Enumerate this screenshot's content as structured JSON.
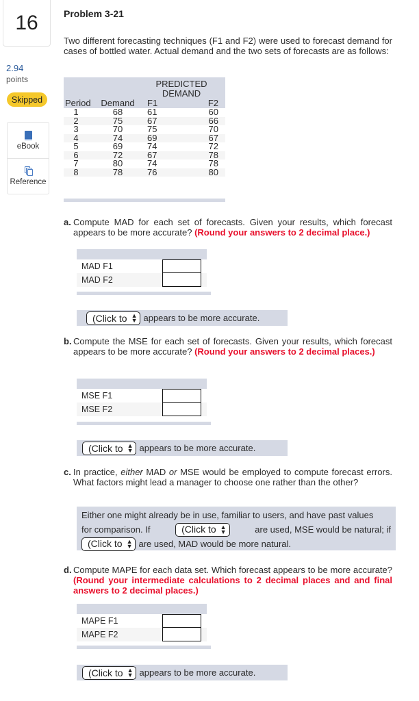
{
  "sidebar": {
    "question_number": "16",
    "points_value": "2.94",
    "points_label": "points",
    "status_badge": "Skipped",
    "tools": [
      {
        "label": "eBook",
        "icon": "book-icon"
      },
      {
        "label": "Reference",
        "icon": "copy-icon"
      }
    ]
  },
  "problem": {
    "title": "Problem 3-21",
    "intro": "Two different forecasting techniques (F1 and F2) were used to forecast demand for cases of bottled water. Actual demand and the two sets of forecasts are as follows:"
  },
  "data_table": {
    "group_header": [
      "PREDICTED",
      "DEMAND"
    ],
    "headers": [
      "Period",
      "Demand",
      "F1",
      "F2"
    ],
    "rows": [
      [
        "1",
        "68",
        "61",
        "60"
      ],
      [
        "2",
        "75",
        "67",
        "66"
      ],
      [
        "3",
        "70",
        "75",
        "70"
      ],
      [
        "4",
        "74",
        "69",
        "67"
      ],
      [
        "5",
        "69",
        "74",
        "72"
      ],
      [
        "6",
        "72",
        "67",
        "78"
      ],
      [
        "7",
        "80",
        "74",
        "78"
      ],
      [
        "8",
        "78",
        "76",
        "80"
      ]
    ]
  },
  "part_a": {
    "letter": "a.",
    "text": "Compute MAD for each set of forecasts. Given your results, which forecast appears to be more accurate?",
    "note": "(Round your answers to 2 decimal place.)",
    "rows": [
      {
        "label": "MAD F1",
        "value": ""
      },
      {
        "label": "MAD F2",
        "value": ""
      }
    ],
    "select_value": "(Click to",
    "select_suffix": "appears to be more accurate."
  },
  "part_b": {
    "letter": "b.",
    "text": "Compute the MSE for each set of forecasts. Given your results, which forecast appears to be more accurate?",
    "note": "(Round your answers to 2 decimal places.)",
    "rows": [
      {
        "label": "MSE F1",
        "value": ""
      },
      {
        "label": "MSE F2",
        "value": ""
      }
    ],
    "select_value": "(Click to",
    "select_suffix": "appears to be more accurate."
  },
  "part_c": {
    "letter": "c.",
    "text_before": "In practice,",
    "em1": "either",
    "text_mid1": "MAD",
    "em2": "or",
    "text_after": "MSE would be employed to compute forecast errors. What factors might lead a manager to choose one rather than the other?",
    "answer_line1": "Either one might already be in use, familiar to users, and have past values",
    "answer_line2_pre": "for comparison. If",
    "select1_value": "(Click to",
    "answer_line2_post": "are used, MSE would be natural; if",
    "select2_value": "(Click to",
    "answer_line3_post": "are used, MAD would be more natural."
  },
  "part_d": {
    "letter": "d.",
    "text": "Compute MAPE for each data set. Which forecast appears to be more accurate?",
    "note": "(Round your intermediate calculations to 2 decimal places and and final answers to 2 decimal places.)",
    "rows": [
      {
        "label": "MAPE F1",
        "value": ""
      },
      {
        "label": "MAPE F2",
        "value": ""
      }
    ],
    "select_value": "(Click to",
    "select_suffix": "appears to be more accurate."
  }
}
